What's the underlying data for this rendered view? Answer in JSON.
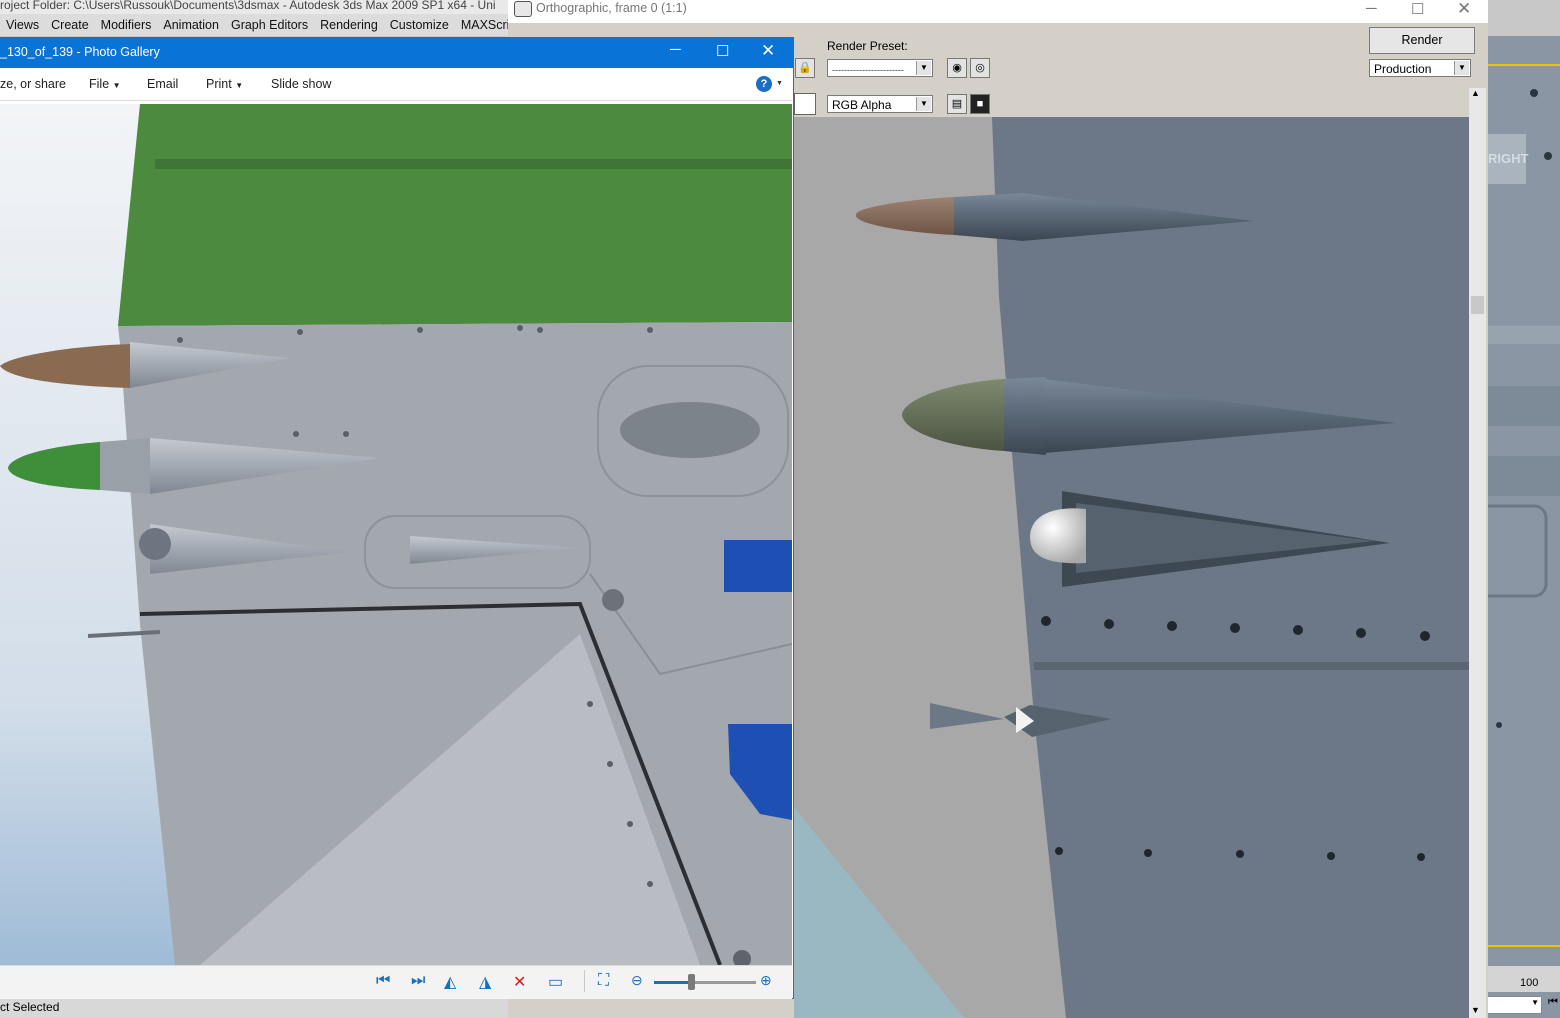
{
  "max": {
    "title": "roject Folder: C:\\Users\\Russouk\\Documents\\3dsmax     - Autodesk 3ds Max  2009 SP1  x64  - Uni",
    "menu": [
      "Views",
      "Create",
      "Modifiers",
      "Animation",
      "Graph Editors",
      "Rendering",
      "Customize",
      "MAXScri"
    ],
    "viewport_label": "RIGHT",
    "timeline_value": "100",
    "status_text": "ct Selected"
  },
  "render_window": {
    "title": "Orthographic, frame 0 (1:1)",
    "render_preset_label": "Render Preset:",
    "preset_value": "------------------------",
    "render_button": "Render",
    "production_value": "Production",
    "channel_value": "RGB Alpha"
  },
  "photo_gallery": {
    "title": "_130_of_139 - Photo Gallery",
    "toolbar": {
      "organize": "ze, or share",
      "file": "File",
      "email": "Email",
      "print": "Print",
      "slideshow": "Slide show"
    },
    "zoom_level": 0.36
  },
  "colors": {
    "gallery_title_bar": "#0a74d6",
    "viewport_highlight": "#f2c200",
    "accent_icon": "#1b6fc2",
    "delete_icon": "#d21f1f"
  }
}
